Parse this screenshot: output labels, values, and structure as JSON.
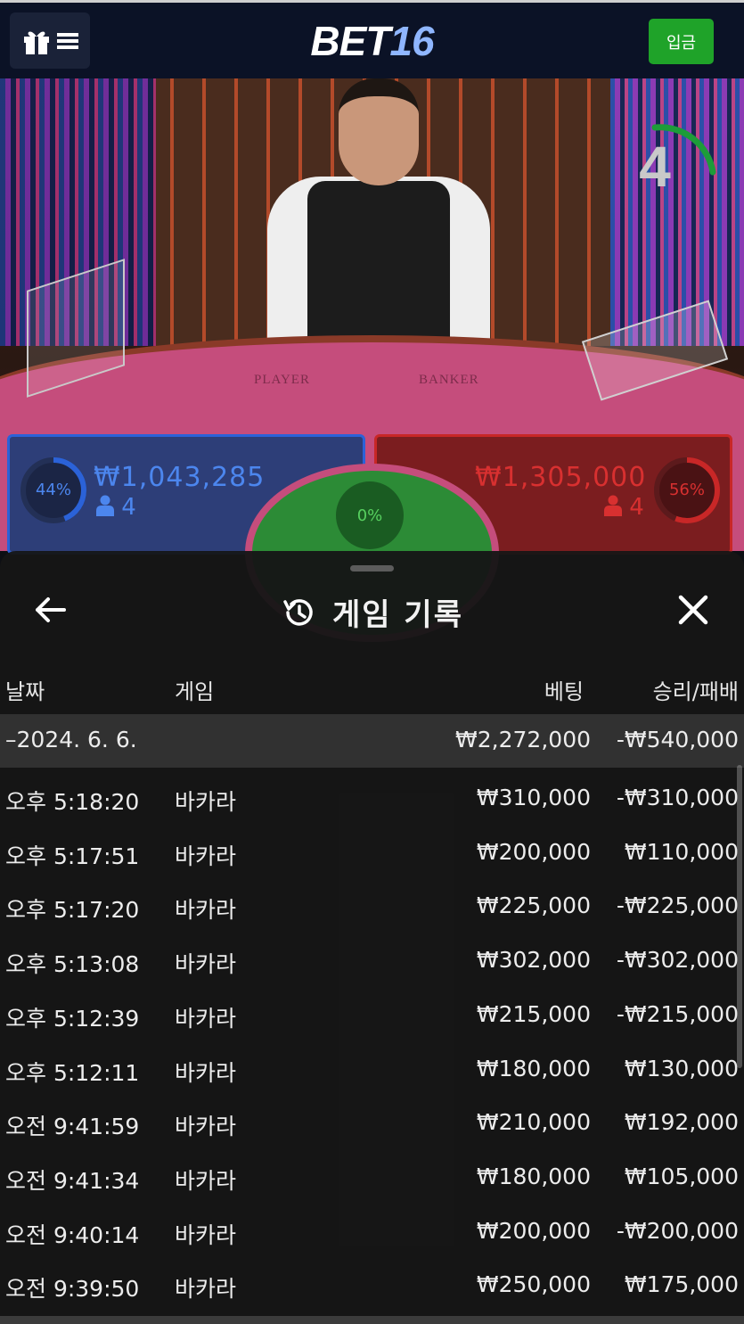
{
  "header": {
    "logo_main": "BET",
    "logo_num": "16",
    "deposit_label": "입금"
  },
  "game": {
    "countdown": "4",
    "table_label_player": "PLAYER",
    "table_label_banker": "BANKER",
    "player": {
      "percent": "44%",
      "percent_value": 44,
      "amount": "₩1,043,285",
      "count": "4"
    },
    "tie": {
      "percent": "0%"
    },
    "banker": {
      "percent": "56%",
      "percent_value": 56,
      "amount": "₩1,305,000",
      "count": "4"
    },
    "colors": {
      "player": "#2b62d8",
      "banker": "#c82727",
      "tie": "#2c8b36"
    }
  },
  "history": {
    "title": "게임 기록",
    "columns": {
      "date": "날짜",
      "game": "게임",
      "bet": "베팅",
      "result": "승리/패배"
    },
    "date_row": {
      "date": "–2024. 6. 6.",
      "bet": "₩2,272,000",
      "result": "-₩540,000"
    },
    "rows": [
      {
        "time": "오후 5:18:20",
        "game": "바카라",
        "bet": "₩310,000",
        "result": "-₩310,000"
      },
      {
        "time": "오후 5:17:51",
        "game": "바카라",
        "bet": "₩200,000",
        "result": "₩110,000"
      },
      {
        "time": "오후 5:17:20",
        "game": "바카라",
        "bet": "₩225,000",
        "result": "-₩225,000"
      },
      {
        "time": "오후 5:13:08",
        "game": "바카라",
        "bet": "₩302,000",
        "result": "-₩302,000"
      },
      {
        "time": "오후 5:12:39",
        "game": "바카라",
        "bet": "₩215,000",
        "result": "-₩215,000"
      },
      {
        "time": "오후 5:12:11",
        "game": "바카라",
        "bet": "₩180,000",
        "result": "₩130,000"
      },
      {
        "time": "오전 9:41:59",
        "game": "바카라",
        "bet": "₩210,000",
        "result": "₩192,000"
      },
      {
        "time": "오전 9:41:34",
        "game": "바카라",
        "bet": "₩180,000",
        "result": "₩105,000"
      },
      {
        "time": "오전 9:40:14",
        "game": "바카라",
        "bet": "₩200,000",
        "result": "-₩200,000"
      },
      {
        "time": "오전 9:39:50",
        "game": "바카라",
        "bet": "₩250,000",
        "result": "₩175,000"
      }
    ]
  },
  "icons": {
    "menu": "gift-menu-icon",
    "back": "arrow-left-icon",
    "history": "history-clock-icon",
    "close": "close-icon",
    "user": "user-icon"
  }
}
